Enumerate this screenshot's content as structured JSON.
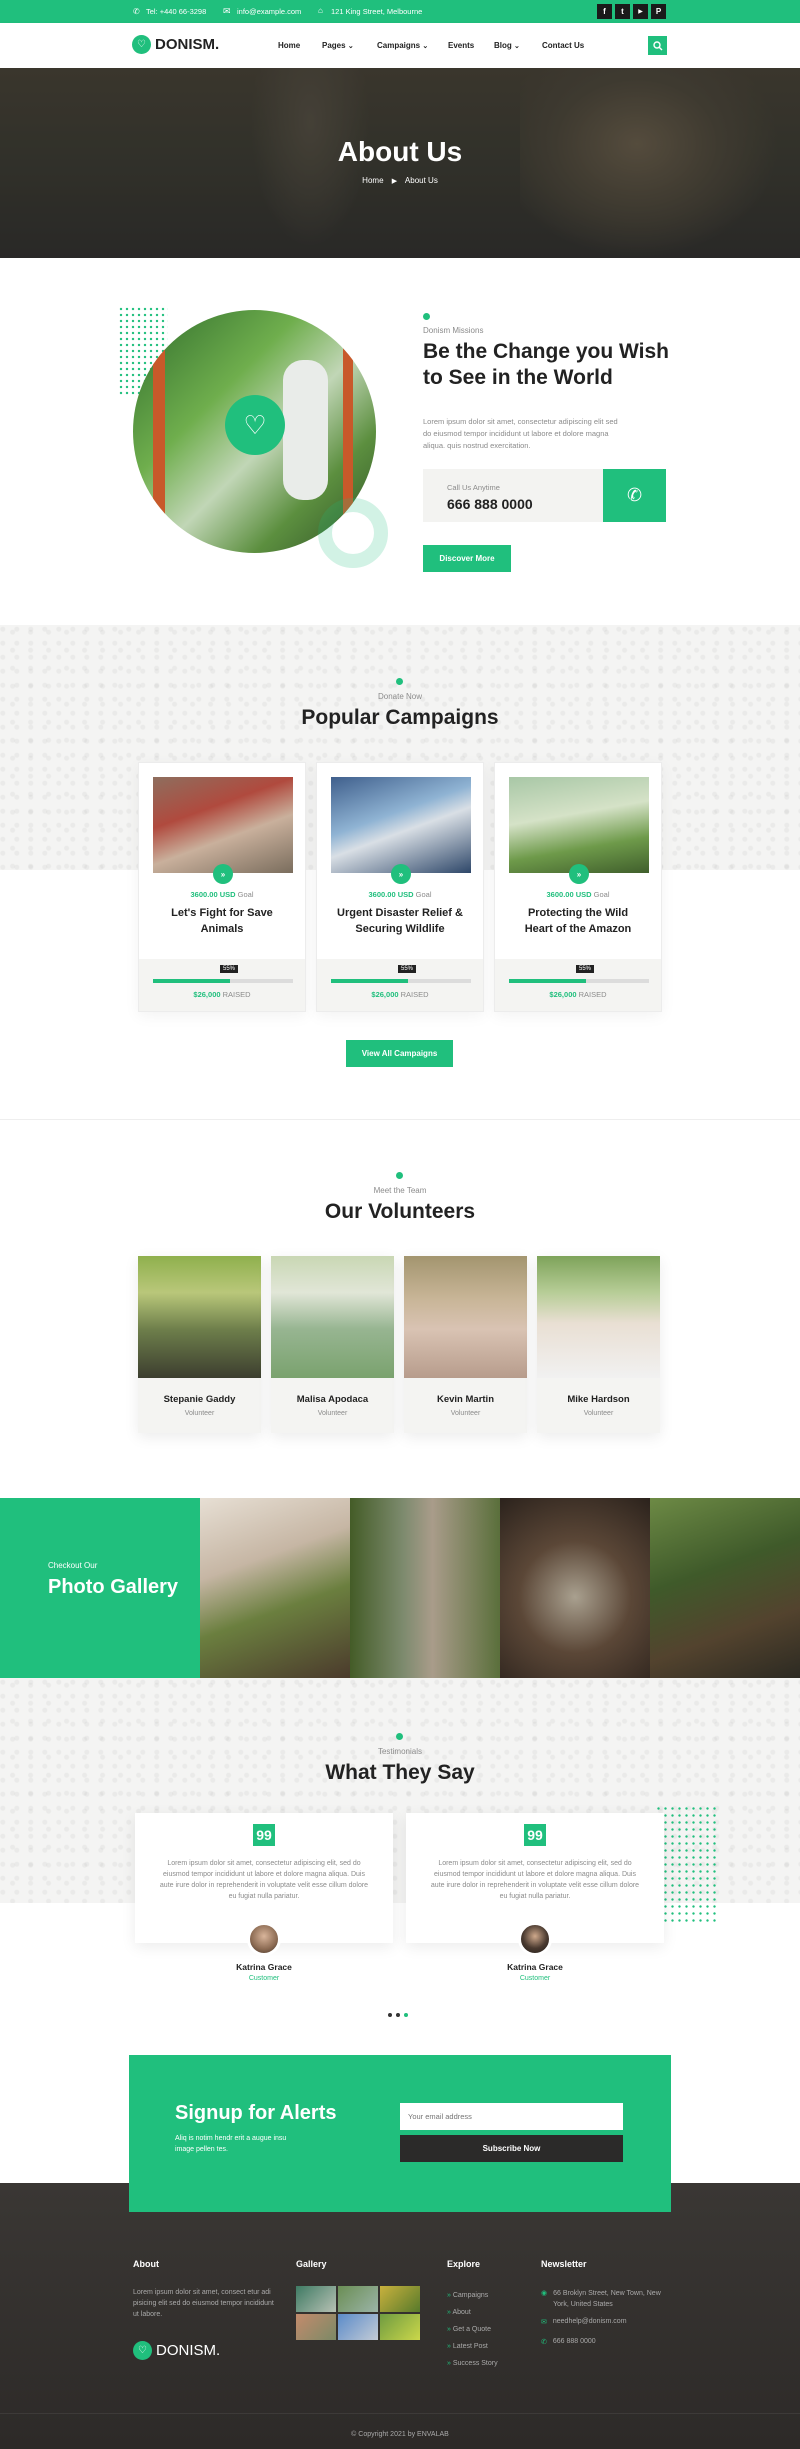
{
  "topbar": {
    "phone": "Tel: +440 66-3298",
    "email": "info@example.com",
    "address": "121 King Street, Melbourne",
    "social": [
      "f",
      "t",
      "▶",
      "P"
    ]
  },
  "header": {
    "logo": "DONISM.",
    "nav": [
      "Home",
      "Pages",
      "Campaigns",
      "Events",
      "Blog",
      "Contact Us"
    ],
    "nav_dropdowns": [
      false,
      true,
      true,
      false,
      true,
      false
    ]
  },
  "hero": {
    "title": "About Us",
    "crumb_home": "Home",
    "crumb_current": "About Us"
  },
  "mission": {
    "kicker": "Donism Missions",
    "title_line1": "Be the Change you Wish",
    "title_line2": "to See in the World",
    "body": "Lorem ipsum dolor sit amet, consectetur adipiscing elit sed do eiusmod tempor incididunt ut labore et dolore magna aliqua. quis nostrud exercitation.",
    "call_label": "Call Us Anytime",
    "call_number": "666 888 0000",
    "button": "Discover More"
  },
  "campaigns": {
    "kicker": "Donate Now",
    "title": "Popular Campaigns",
    "items": [
      {
        "goal_amount": "3600.00 USD",
        "goal_word": "Goal",
        "title_1": "Let's Fight for Save",
        "title_2": "Animals",
        "percent_label": "55%",
        "progress": 0.55,
        "raised_amount": "$26,000",
        "raised_word": "RAISED"
      },
      {
        "goal_amount": "3600.00 USD",
        "goal_word": "Goal",
        "title_1": "Urgent Disaster Relief &",
        "title_2": "Securing Wildlife",
        "percent_label": "55%",
        "progress": 0.55,
        "raised_amount": "$26,000",
        "raised_word": "RAISED"
      },
      {
        "goal_amount": "3600.00 USD",
        "goal_word": "Goal",
        "title_1": "Protecting the Wild",
        "title_2": "Heart of the Amazon",
        "percent_label": "55%",
        "progress": 0.55,
        "raised_amount": "$26,000",
        "raised_word": "RAISED"
      }
    ],
    "button": "View All Campaigns"
  },
  "volunteers": {
    "kicker": "Meet the Team",
    "title": "Our Volunteers",
    "items": [
      {
        "name": "Stepanie Gaddy",
        "role": "Volunteer"
      },
      {
        "name": "Malisa Apodaca",
        "role": "Volunteer"
      },
      {
        "name": "Kevin Martin",
        "role": "Volunteer"
      },
      {
        "name": "Mike Hardson",
        "role": "Volunteer"
      }
    ]
  },
  "gallery": {
    "kicker": "Checkout Our",
    "title": "Photo Gallery"
  },
  "testimonials": {
    "kicker": "Testimonials",
    "title": "What They Say",
    "items": [
      {
        "text": "Lorem ipsum dolor sit amet, consectetur adipiscing elit, sed do eiusmod tempor incididunt ut labore et dolore magna aliqua. Duis aute irure dolor in reprehenderit in voluptate velit esse cillum dolore eu fugiat nulla pariatur.",
        "name": "Katrina Grace",
        "role": "Customer"
      },
      {
        "text": "Lorem ipsum dolor sit amet, consectetur adipiscing elit, sed do eiusmod tempor incididunt ut labore et dolore magna aliqua. Duis aute irure dolor in reprehenderit in voluptate velit esse cillum dolore eu fugiat nulla pariatur.",
        "name": "Katrina Grace",
        "role": "Customer"
      }
    ]
  },
  "signup": {
    "title": "Signup for Alerts",
    "body": "Aliq is notim hendr erit a augue insu image pellen tes.",
    "placeholder": "Your email address",
    "button": "Subscribe Now"
  },
  "footer": {
    "about_title": "About",
    "about_text": "Lorem ipsum dolor sit amet, consect etur adi pisicing elit sed do eiusmod tempor incididunt ut labore.",
    "logo": "DONISM.",
    "gallery_title": "Gallery",
    "explore_title": "Explore",
    "explore_links": [
      "Campaigns",
      "About",
      "Get a Quote",
      "Latest Post",
      "Success Story"
    ],
    "newsletter_title": "Newsletter",
    "address": "66 Broklyn Street, New Town, New York, United States",
    "email": "needhelp@donism.com",
    "phone": "666 888 0000",
    "copyright": "© Copyright 2021 by ENVALAB"
  },
  "colors": {
    "accent": "#20bf7d",
    "dark": "#2f2c2c"
  }
}
